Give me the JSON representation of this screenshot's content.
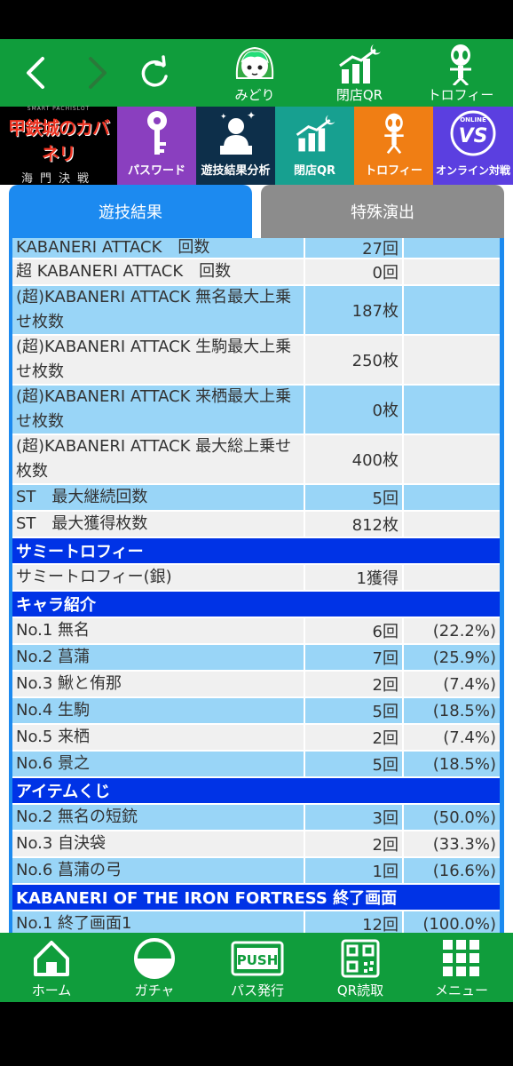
{
  "top_nav": {
    "items": [
      {
        "label": "みどり",
        "icon": "midori-character-icon"
      },
      {
        "label": "閉店QR",
        "icon": "chart-moon-icon"
      },
      {
        "label": "トロフィー",
        "icon": "alien-trophy-icon"
      }
    ]
  },
  "menu": {
    "logo_top": "SMART PACHISLOT",
    "logo_main": "甲鉄城のカバネリ",
    "logo_sub": "海門決戦",
    "tiles": [
      {
        "label": "パスワード",
        "color": "#8a3fbf"
      },
      {
        "label": "遊技結果分析",
        "color": "#0d2f4a"
      },
      {
        "label": "閉店QR",
        "color": "#17a090"
      },
      {
        "label": "トロフィー",
        "color": "#f07e14"
      },
      {
        "label": "オンライン対戦",
        "color": "#5b3fe0"
      }
    ],
    "vs_small": "ONLINE",
    "vs_big": "VS"
  },
  "tabs": {
    "active": "遊技結果",
    "inactive": "特殊演出"
  },
  "rows_a": [
    {
      "label": "KABANERI ATTACK　回数",
      "value": "27回",
      "pct": "",
      "style": "blue"
    },
    {
      "label": "超 KABANERI ATTACK　回数",
      "value": "0回",
      "pct": "",
      "style": "gray"
    },
    {
      "label": "(超)KABANERI ATTACK 無名最大上乗せ枚数",
      "value": "187枚",
      "pct": "",
      "style": "blue"
    },
    {
      "label": "(超)KABANERI ATTACK 生駒最大上乗せ枚数",
      "value": "250枚",
      "pct": "",
      "style": "gray"
    },
    {
      "label": "(超)KABANERI ATTACK 来栖最大上乗せ枚数",
      "value": "0枚",
      "pct": "",
      "style": "blue"
    },
    {
      "label": "(超)KABANERI ATTACK 最大総上乗せ枚数",
      "value": "400枚",
      "pct": "",
      "style": "gray"
    },
    {
      "label": "ST　最大継続回数",
      "value": "5回",
      "pct": "",
      "style": "blue"
    },
    {
      "label": "ST　最大獲得枚数",
      "value": "812枚",
      "pct": "",
      "style": "gray"
    }
  ],
  "section_trophy": "サミートロフィー",
  "rows_trophy": [
    {
      "label": "サミートロフィー(銀)",
      "value": "1獲得",
      "pct": "",
      "style": "gray"
    }
  ],
  "section_chara": "キャラ紹介",
  "rows_chara": [
    {
      "label": "No.1 無名",
      "value": "6回",
      "pct": "(22.2%)",
      "style": "gray"
    },
    {
      "label": "No.2 菖蒲",
      "value": "7回",
      "pct": "(25.9%)",
      "style": "blue"
    },
    {
      "label": "No.3 鰍と侑那",
      "value": "2回",
      "pct": "(7.4%)",
      "style": "gray"
    },
    {
      "label": "No.4 生駒",
      "value": "5回",
      "pct": "(18.5%)",
      "style": "blue"
    },
    {
      "label": "No.5 来栖",
      "value": "2回",
      "pct": "(7.4%)",
      "style": "gray"
    },
    {
      "label": "No.6 景之",
      "value": "5回",
      "pct": "(18.5%)",
      "style": "blue"
    }
  ],
  "section_item": "アイテムくじ",
  "rows_item": [
    {
      "label": "No.2 無名の短銃",
      "value": "3回",
      "pct": "(50.0%)",
      "style": "blue"
    },
    {
      "label": "No.3 自決袋",
      "value": "2回",
      "pct": "(33.3%)",
      "style": "gray"
    },
    {
      "label": "No.6 菖蒲の弓",
      "value": "1回",
      "pct": "(16.6%)",
      "style": "blue"
    }
  ],
  "section_end": "KABANERI OF THE IRON FORTRESS 終了画面",
  "rows_end": [
    {
      "label": "No.1 終了画面1",
      "value": "12回",
      "pct": "(100.0%)",
      "style": "blue"
    }
  ],
  "bottom_nav": [
    {
      "label": "ホーム",
      "icon": "home-icon"
    },
    {
      "label": "ガチャ",
      "icon": "gacha-capsule-icon"
    },
    {
      "label": "パス発行",
      "icon": "push-pass-icon"
    },
    {
      "label": "QR読取",
      "icon": "qr-code-icon"
    },
    {
      "label": "メニュー",
      "icon": "grid-menu-icon"
    }
  ],
  "bottom_push_text": "PUSH",
  "colors": {
    "brand_green": "#109d3c",
    "tab_blue": "#1c8af0",
    "section_blue": "#0033e6",
    "row_blue": "#99d5f7",
    "row_gray": "#f0f0f0"
  }
}
